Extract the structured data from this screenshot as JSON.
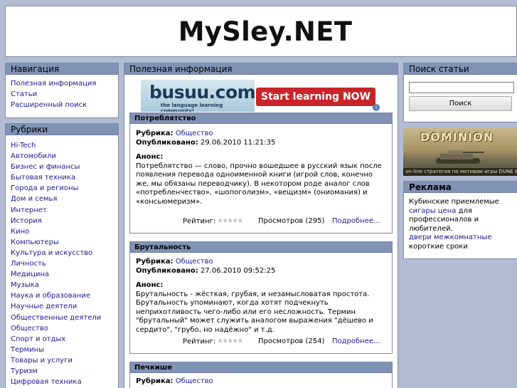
{
  "site": {
    "title": "MySley.NET"
  },
  "navigation": {
    "title": "Навигация",
    "items": [
      "Полезная информация",
      "Статьи",
      "Расширенный поиск"
    ]
  },
  "rubrics": {
    "title": "Рубрики",
    "items": [
      "Hi-Tech",
      "Автомобили",
      "Бизнес и финансы",
      "Бытовая техника",
      "Города и регионы",
      "Дом и семья",
      "Интернет",
      "История",
      "Кино",
      "Компьютеры",
      "Культура и искусство",
      "Личность",
      "Медицина",
      "Музыка",
      "Наука и образование",
      "Научные деятели",
      "Общественные деятели",
      "Общество",
      "Спорт и отдых",
      "Термины",
      "Товары и услуги",
      "Туризм",
      "Цифровая техника"
    ]
  },
  "main": {
    "title": "Полезная информация"
  },
  "busuu_ad": {
    "brand": "busuu.com",
    "tagline": "the language learning community!",
    "cta": "Start learning NOW",
    "info": "i"
  },
  "labels": {
    "rubric": "Рубрика:",
    "published": "Опубликовано:",
    "anons": "Анонс:",
    "rating": "Рейтинг:",
    "more": "Подробнее..."
  },
  "articles": [
    {
      "title": "Потреблятство",
      "rubric": "Общество",
      "published": "29.06.2010 11:21:35",
      "anons": "Потреблятство — слово, прочно вошедшее в русский язык после появления перевода одноименной книги (игрой слов, конечно же, мы обязаны переводчику). В некотором роде аналог слов «потребленчество», «шопоголизм», «вещизм» (ониомания) и «консьюмеризм».",
      "views": "Просмотров (295)",
      "rating": 0
    },
    {
      "title": "Брутальность",
      "rubric": "Общество",
      "published": "27.06.2010 09:52:25",
      "anons": "Брутальность - жёсткая, грубая, и незамысловатая простота. Брутальность упоминают, когда хотят подчекнуть неприхотливость чего-либо или его несложность. Термин \"брутальный\" может служить аналогом выражения \"дёшево и сердито\", \"грубо, но надёжно\" и т.д.",
      "views": "Просмотров (254)",
      "rating": 0
    },
    {
      "title": "Печкише",
      "rubric": "Общество"
    }
  ],
  "search": {
    "title": "Поиск статьи",
    "value": "",
    "button": "Поиск"
  },
  "dominion_ad": {
    "title": "DOMINION",
    "caption": "on-line стратегия по мотивам игры DUNE II"
  },
  "ads": {
    "title": "Реклама",
    "text1": "Кубинские приемлемые",
    "link1": "сигары цена",
    "text2": "для профессионалов и любителей.",
    "link2": "двери межкомнатные",
    "text3": "короткие сроки"
  }
}
